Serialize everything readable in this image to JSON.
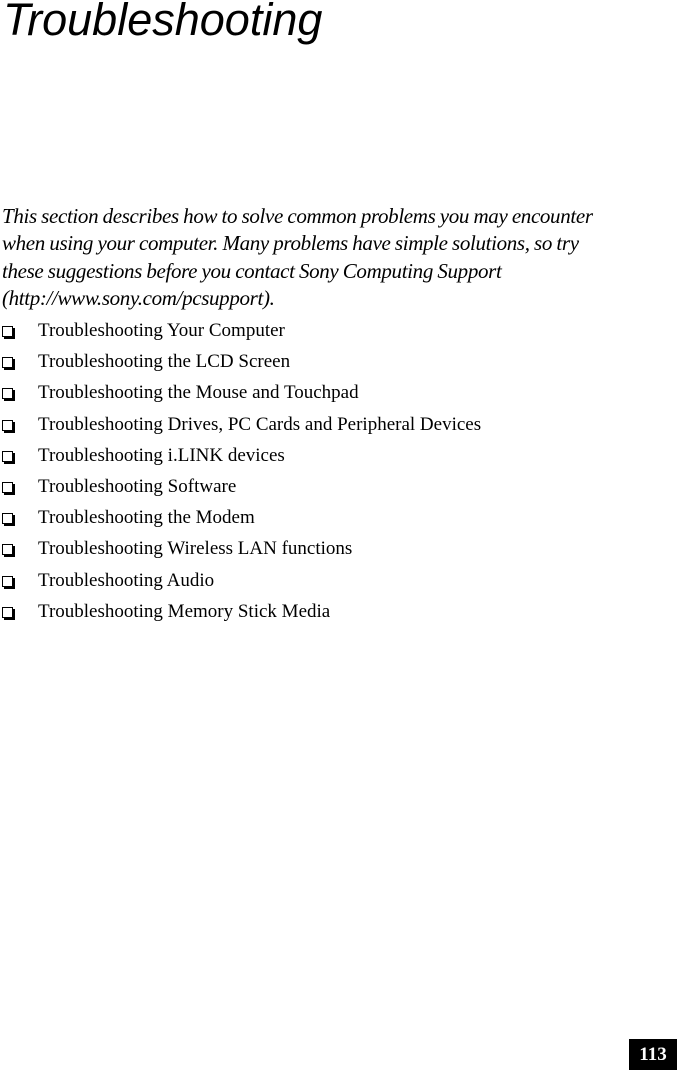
{
  "page": {
    "title": "Troubleshooting",
    "intro_lines": [
      "This section describes how to solve common problems you may encounter",
      "when using your computer. Many problems have simple solutions, so try",
      "these suggestions before you contact Sony Computing Support",
      "(http://www.sony.com/pcsupport)."
    ],
    "bullet_icon": "checkbox-square-icon",
    "topics": [
      {
        "label": "Troubleshooting Your Computer"
      },
      {
        "label": "Troubleshooting the LCD Screen"
      },
      {
        "label": "Troubleshooting the Mouse and Touchpad"
      },
      {
        "label": "Troubleshooting Drives, PC Cards and Peripheral Devices"
      },
      {
        "label": "Troubleshooting i.LINK devices"
      },
      {
        "label": "Troubleshooting Software"
      },
      {
        "label": "Troubleshooting the Modem"
      },
      {
        "label": "Troubleshooting Wireless LAN functions"
      },
      {
        "label": "Troubleshooting Audio"
      },
      {
        "label": "Troubleshooting Memory Stick Media"
      }
    ],
    "page_number": "113"
  }
}
